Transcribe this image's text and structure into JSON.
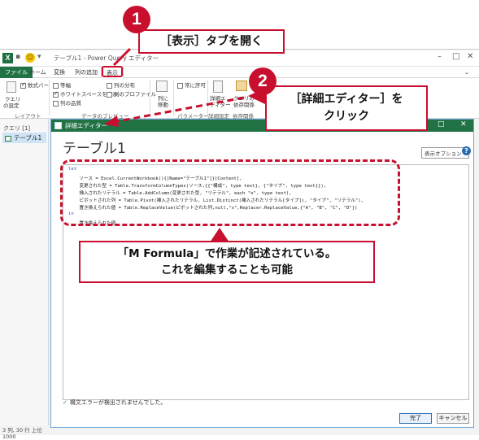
{
  "window": {
    "title": "テーブル1 - Power Query エディター",
    "logo": "X"
  },
  "ribbon": {
    "tabs": [
      "ファイル",
      "ホーム",
      "変換",
      "列の追加",
      "表示"
    ],
    "active_tab": "表示",
    "query_settings_label": [
      "クエリ",
      "の設定"
    ],
    "formula_bar_label": "数式バー",
    "layout_group": "レイアウト",
    "monospace_label": "等幅",
    "show_whitespace_label": "ホワイトスペースを表示",
    "column_quality_label": "列の品質",
    "column_distribution_label": "列の分布",
    "column_profile_label": "列のプロファイル",
    "data_preview_group": "データのプレビュー",
    "go_to_column_label": [
      "列に",
      "移動"
    ],
    "always_allow_label": "常に許可",
    "advanced_editor_label": [
      "詳細エ",
      "ディター"
    ],
    "query_dependencies_label": [
      "クエリの",
      "依存関係"
    ],
    "parameters_group": "パラメーター",
    "advanced_group": "詳細設定",
    "dependencies_group": "依存関係"
  },
  "left_pane": {
    "header": "クエリ [1]",
    "item": "テーブル1"
  },
  "status_bar": "3 列, 30 行  上位 1000",
  "dialog": {
    "title": "詳細エディター",
    "query_name": "テーブル1",
    "display_options": "表示オプション ▾",
    "help": "?",
    "code_lines": [
      "let",
      "    ソース = Excel.CurrentWorkbook(){[Name=\"テーブル1\"]}[Content],",
      "    変更された型 = Table.TransformColumnTypes(ソース,{{\"構成\", type text}, {\"タイプ\", type text}}),",
      "    挿入されたリテラル = Table.AddColumn(変更された型, \"リテラル\", each \"o\", type text),",
      "    ピボットされた列 = Table.Pivot(挿入されたリテラル, List.Distinct(挿入されたリテラル[タイプ]), \"タイプ\", \"リテラル\"),",
      "    置き換えられた値 = Table.ReplaceValue(ピボットされた列,null,\"x\",Replacer.ReplaceValue,{\"A\", \"B\", \"C\", \"D\"})",
      "in",
      "    置き換えられた値"
    ],
    "syntax_status": "構文エラーが検出されませんでした。",
    "done_button": "完了",
    "cancel_button": "キャンセル"
  },
  "annotations": {
    "step1_number": "1",
    "step1_text": "［表示］タブを開く",
    "step2_number": "2",
    "step2_text_line1": "［詳細エディター］を",
    "step2_text_line2": "クリック",
    "note_line1": "「M Formula」で作業が記述されている。",
    "note_line2": "これを編集することも可能",
    "accent_color": "#c8102e"
  }
}
